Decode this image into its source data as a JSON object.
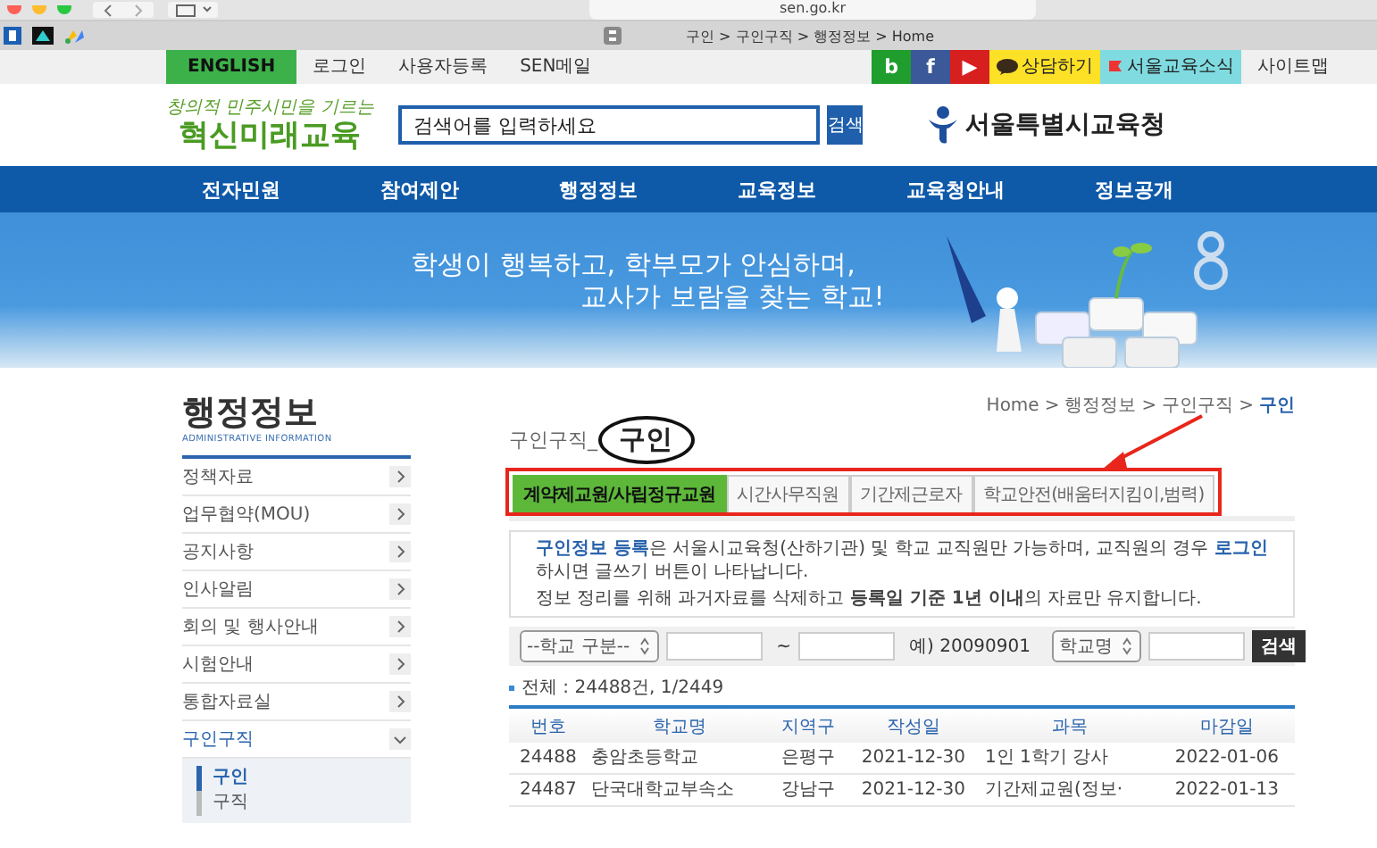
{
  "browser": {
    "address": "sen.go.kr",
    "tab_title": "구인 > 구인구직 > 행정정보 > Home"
  },
  "utility_bar": {
    "links": [
      {
        "label": "ENGLISH",
        "kind": "highlight"
      },
      {
        "label": "로그인",
        "kind": "plain"
      },
      {
        "label": "사용자등록",
        "kind": "plain"
      },
      {
        "label": "SEN메일",
        "kind": "plain"
      }
    ],
    "social": [
      {
        "label": "b",
        "color": "#1f9d2d"
      },
      {
        "label": "f",
        "color": "#3b5998"
      },
      {
        "label": "▶",
        "color": "#d71f1f"
      }
    ],
    "badges": [
      {
        "label": "상담하기",
        "color": "#fde127"
      },
      {
        "label": "서울교육소식",
        "color": "#7fdbe0"
      }
    ],
    "sitemap": "사이트맵"
  },
  "header": {
    "slogan": "창의적 민주시민을 기르는",
    "logo": "혁신미래교육",
    "search": {
      "placeholder": "검색어를 입력하세요"
    },
    "search_button": "검색",
    "agency": "서울특별시교육청"
  },
  "nav": [
    "전자민원",
    "참여제안",
    "행정정보",
    "교육정보",
    "교육청안내",
    "정보공개"
  ],
  "banner": {
    "line_1": "학생이 행복하고, 학부모가 안심하며,",
    "line_2": "교사가 보람을 찾는 학교!"
  },
  "sidebar": {
    "title": "행정정보",
    "subtitle": "ADMINISTRATIVE INFORMATION",
    "items": [
      {
        "label": "정책자료",
        "selected": false,
        "expanded": false
      },
      {
        "label": "업무협약(MOU)",
        "selected": false,
        "expanded": false
      },
      {
        "label": "공지사항",
        "selected": false,
        "expanded": false
      },
      {
        "label": "인사알림",
        "selected": false,
        "expanded": false
      },
      {
        "label": "회의 및 행사안내",
        "selected": false,
        "expanded": false
      },
      {
        "label": "시험안내",
        "selected": false,
        "expanded": false
      },
      {
        "label": "통합자료실",
        "selected": false,
        "expanded": false
      },
      {
        "label": "구인구직",
        "selected": true,
        "expanded": true,
        "children": [
          {
            "label": "구인",
            "selected": true
          },
          {
            "label": "구직",
            "selected": false
          }
        ]
      }
    ]
  },
  "main": {
    "breadcrumb": {
      "items": [
        "Home",
        "행정정보",
        "구인구직",
        "구인"
      ],
      "separator": ">"
    },
    "section": "구인구직_",
    "title": "구인",
    "tabs": [
      {
        "label": "계약제교원/사립정규교원",
        "selected": true
      },
      {
        "label": "시간사무직원",
        "selected": false
      },
      {
        "label": "기간제근로자",
        "selected": false
      },
      {
        "label": "학교안전(배움터지킴이,범력)",
        "selected": false
      }
    ],
    "notes": [
      {
        "kind": "accent",
        "text": "**구인정보 등록**은 서울시교육청(산하기관) 및 학교 교직원만 가능하며, 교직원의 경우 **로그인**하시면 글쓰기 버튼이 나타납니다."
      },
      {
        "kind": "plain",
        "text": "정보 정리를 위해 과거자료를 삭제하고 **등록일 기준 1년 이내**의 자료만 유지합니다."
      }
    ],
    "filter": {
      "school_type": "--학교 구분--",
      "range_separator": "~",
      "date_hint": "예) 20090901",
      "school_field": "학교명",
      "search_button": "검색"
    },
    "count": "전체 : 24488건, 1/2449",
    "table": {
      "columns": [
        "번호",
        "학교명",
        "지역구",
        "작성일",
        "과목",
        "마감일"
      ],
      "rows": [
        [
          "24488",
          "충암초등학교",
          "은평구",
          "2021-12-30",
          "1인 1학기 강사",
          "2022-01-06"
        ],
        [
          "24487",
          "단국대학교부속소",
          "강남구",
          "2021-12-30",
          "기간제교원(정보·",
          "2022-01-13"
        ]
      ]
    }
  }
}
